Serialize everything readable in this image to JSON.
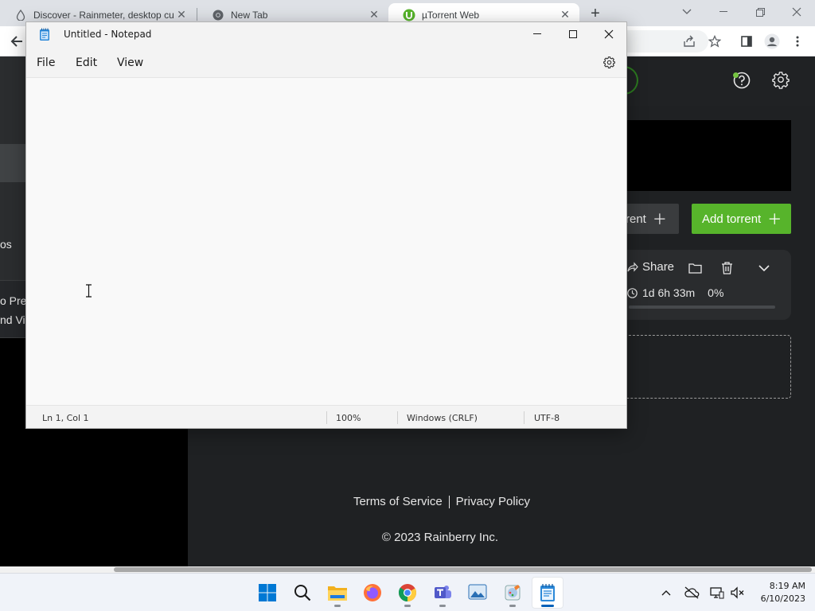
{
  "browser": {
    "tabs": [
      {
        "title": "Discover - Rainmeter, desktop cu",
        "icon": "rainmeter-drop-icon"
      },
      {
        "title": "New Tab",
        "icon": "chrome-icon"
      },
      {
        "title": "µTorrent Web",
        "icon": "utorrent-icon",
        "active": true
      }
    ],
    "new_tab_label": "+"
  },
  "utorrent": {
    "sidebar_partial_text": [
      "os",
      "o Pre",
      "nd Vi"
    ],
    "buttons": {
      "create_partial": "rent",
      "add_torrent": "Add torrent"
    },
    "torrent": {
      "share_label": "Share",
      "eta": "1d 6h 33m",
      "progress": "0%"
    },
    "footer": {
      "terms": "Terms of Service",
      "privacy": "Privacy Policy",
      "copyright": "© 2023 Rainberry Inc."
    },
    "colors": {
      "accent": "#57b42b",
      "background": "#1f2123"
    }
  },
  "notepad": {
    "title": "Untitled - Notepad",
    "menu": [
      "File",
      "Edit",
      "View"
    ],
    "content": "",
    "status": {
      "position": "Ln 1, Col 1",
      "zoom": "100%",
      "line_endings": "Windows (CRLF)",
      "encoding": "UTF-8"
    }
  },
  "taskbar": {
    "apps": [
      "start-icon",
      "search-icon",
      "file-explorer-icon",
      "firefox-icon",
      "chrome-icon",
      "teams-icon",
      "photos-icon",
      "paint-icon",
      "notepad-icon"
    ],
    "clock": {
      "time": "8:19 AM",
      "date": "6/10/2023"
    }
  }
}
